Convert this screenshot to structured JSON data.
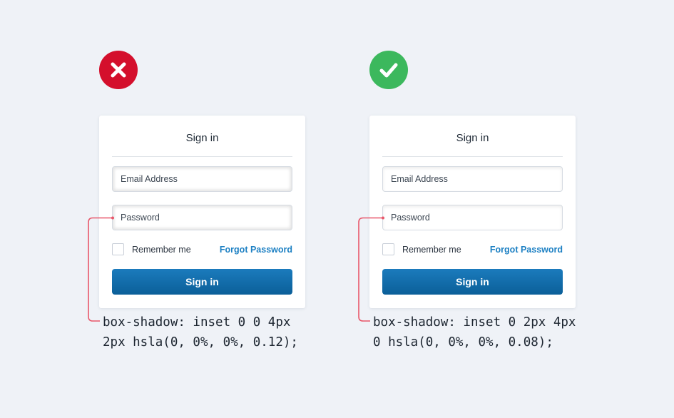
{
  "colors": {
    "bad": "#d40f2c",
    "good": "#3cb85d",
    "link": "#1d80c3",
    "button": "#0f6aa8",
    "callout_line": "#e8576a"
  },
  "panels": [
    {
      "status": "incorrect",
      "status_icon": "close-x-icon",
      "card": {
        "title": "Sign in",
        "email_placeholder": "Email Address",
        "password_placeholder": "Password",
        "remember_label": "Remember me",
        "forgot_link": "Forgot Password",
        "button_label": "Sign in"
      },
      "code_line1": "box-shadow: inset 0 0 4px",
      "code_line2": "2px hsla(0, 0%, 0%, 0.12);"
    },
    {
      "status": "correct",
      "status_icon": "checkmark-icon",
      "card": {
        "title": "Sign in",
        "email_placeholder": "Email Address",
        "password_placeholder": "Password",
        "remember_label": "Remember me",
        "forgot_link": "Forgot Password",
        "button_label": "Sign in"
      },
      "code_line1": "box-shadow: inset 0 2px 4px",
      "code_line2": "0 hsla(0, 0%, 0%, 0.08);"
    }
  ]
}
